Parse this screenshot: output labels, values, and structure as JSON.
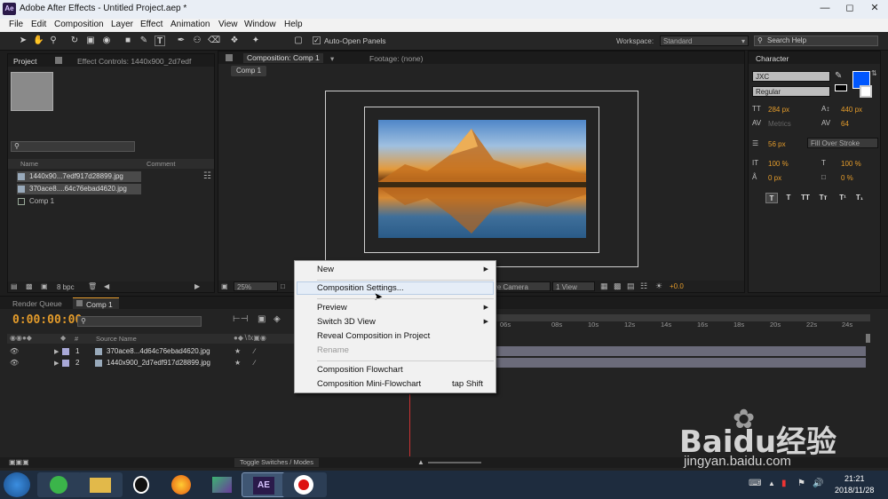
{
  "window": {
    "title": "Adobe After Effects - Untitled Project.aep *",
    "logo_text": "Ae"
  },
  "menu": [
    "File",
    "Edit",
    "Composition",
    "Layer",
    "Effect",
    "Animation",
    "View",
    "Window",
    "Help"
  ],
  "toolbar": {
    "auto_open_label": "Auto-Open Panels",
    "workspace_label": "Workspace:",
    "workspace_value": "Standard",
    "search_placeholder": "Search Help"
  },
  "project_panel": {
    "tab_project": "Project",
    "tab_effects": "Effect Controls: 1440x900_2d7edf",
    "col_name": "Name",
    "col_comment": "Comment",
    "items": [
      "1440x90...7edf917d28899.jpg",
      "370ace8....64c76ebad4620.jpg",
      "Comp 1"
    ],
    "bpc": "8 bpc"
  },
  "comp_panel": {
    "tab_comp": "Composition: Comp 1",
    "tab_footage": "Footage: (none)",
    "crumb": "Comp 1",
    "zoom": "25%",
    "camera": "ive Camera",
    "views": "1 View",
    "exposure": "+0.0"
  },
  "context_menu": {
    "items": [
      "New",
      "Composition Settings...",
      "Preview",
      "Switch 3D View",
      "Reveal Composition in Project",
      "Rename",
      "Composition Flowchart",
      "Composition Mini-Flowchart"
    ],
    "shortcut_mini": "tap Shift"
  },
  "character": {
    "tab": "Character",
    "font": "JXC",
    "style": "Regular",
    "size": "284 px",
    "leading": "440 px",
    "kerning": "Metrics",
    "tracking": "64",
    "stroke": "56 px",
    "stroke_mode": "Fill Over Stroke",
    "vscale": "100 %",
    "hscale": "100 %",
    "baseline": "0 px",
    "tsume": "0 %",
    "fill_color": "#0057ff",
    "style_buttons": [
      "T",
      "T",
      "TT",
      "Tт",
      "T¹",
      "T₁"
    ]
  },
  "timeline": {
    "tab_render": "Render Queue",
    "tab_comp": "Comp 1",
    "timecode": "0:00:00:00",
    "col_source": "Source Name",
    "ticks": [
      "06s",
      "08s",
      "10s",
      "12s",
      "14s",
      "16s",
      "18s",
      "20s",
      "22s",
      "24s"
    ],
    "layers": [
      {
        "num": "1",
        "name": "370ace8...4d64c76ebad4620.jpg"
      },
      {
        "num": "2",
        "name": "1440x900_2d7edf917d28899.jpg"
      }
    ],
    "toggle_label": "Toggle Switches / Modes"
  },
  "taskbar": {
    "time": "21:21",
    "date": "2018/11/28",
    "ae_label": "AE"
  },
  "watermark": {
    "text": "Baidu经验",
    "url": "jingyan.baidu.com"
  }
}
